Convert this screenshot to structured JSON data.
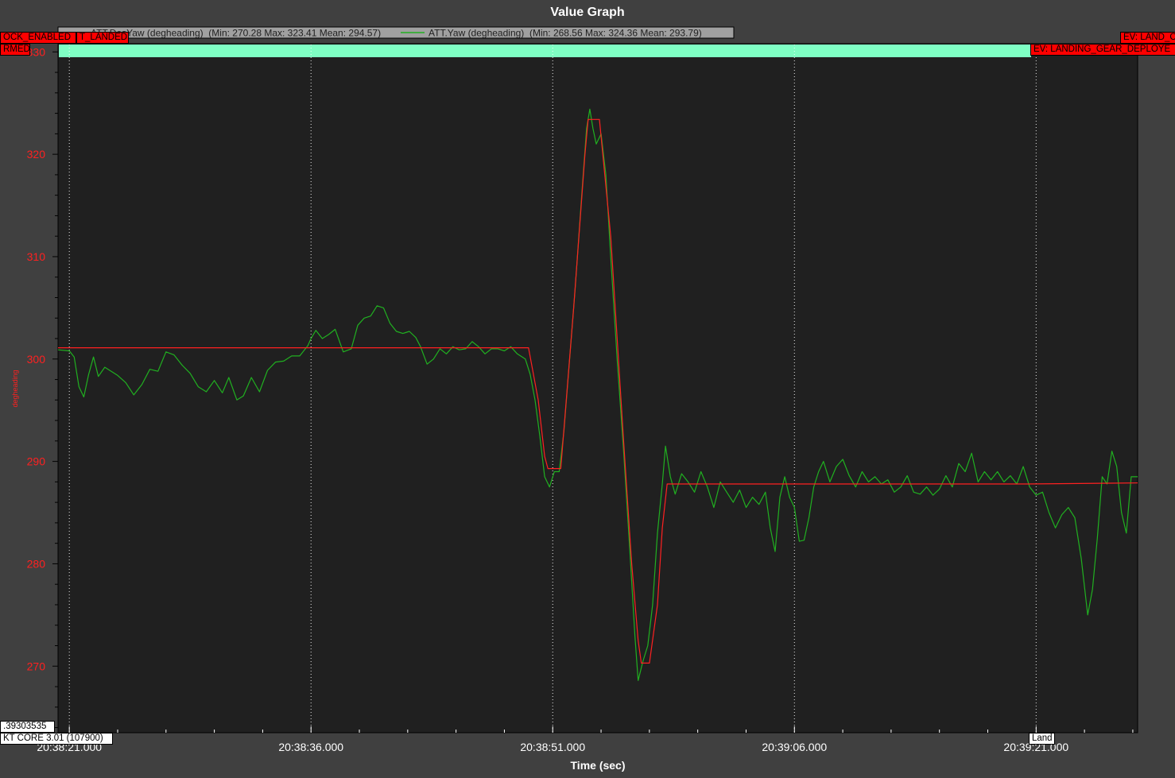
{
  "window": {
    "title": "Value Graph"
  },
  "colors": {
    "background": "#404040",
    "plot_background": "#202020",
    "axis_text": "#ff2020",
    "tick_text": "#ffffff",
    "grid": "#ffffff",
    "mode_band": "#7fffc4",
    "event_tag": "#ff0000"
  },
  "events": {
    "top_left_1": "OCK_ENABLED",
    "top_left_2": "T_LANDED",
    "top_left_3": "RMED",
    "top_right_1": "EV: LAND_C",
    "top_right_2": "EV: LANDING_GEAR_DEPLOYE",
    "bottom_land": "Land"
  },
  "info": {
    "value_box": ".39303535",
    "firmware_box": "KT CORE 3.01 (107900)"
  },
  "chart_data": {
    "type": "line",
    "title": "Value Graph",
    "xlabel": "Time (sec)",
    "ylabel": "degheading",
    "x_unit": "seconds from 20:38:21.000",
    "xlim": [
      -0.7,
      66.3
    ],
    "ylim": [
      263.5,
      330.8
    ],
    "y_ticks": [
      270,
      280,
      290,
      300,
      310,
      320,
      330
    ],
    "x_ticks": [
      {
        "t": 0,
        "label": "20:38:21.000"
      },
      {
        "t": 15,
        "label": "20:38:36.000"
      },
      {
        "t": 30,
        "label": "20:38:51.000"
      },
      {
        "t": 45,
        "label": "20:39:06.000"
      },
      {
        "t": 60,
        "label": "20:39:21.000"
      }
    ],
    "grid": true,
    "legend_position": "top",
    "series": [
      {
        "name": "ATT.DesYaw (degheading)  (Min: 270.28 Max: 323.41 Mean: 294.57)",
        "color": "#ff2020",
        "points": [
          [
            -0.7,
            301.1
          ],
          [
            28.5,
            301.1
          ],
          [
            29.1,
            296.0
          ],
          [
            29.5,
            290.5
          ],
          [
            29.7,
            289.3
          ],
          [
            30.5,
            289.3
          ],
          [
            31.3,
            305.0
          ],
          [
            32.0,
            320.0
          ],
          [
            32.2,
            323.4
          ],
          [
            32.9,
            323.4
          ],
          [
            33.6,
            312.0
          ],
          [
            34.4,
            292.0
          ],
          [
            34.9,
            280.0
          ],
          [
            35.3,
            272.5
          ],
          [
            35.5,
            270.3
          ],
          [
            36.0,
            270.3
          ],
          [
            36.5,
            276.0
          ],
          [
            36.8,
            283.5
          ],
          [
            37.1,
            287.8
          ],
          [
            59.5,
            287.8
          ],
          [
            66.3,
            287.9
          ]
        ]
      },
      {
        "name": "ATT.Yaw (degheading)  (Min: 268.56 Max: 324.36 Mean: 293.79)",
        "color": "#20b020",
        "points": [
          [
            -0.7,
            300.9
          ],
          [
            0.0,
            300.8
          ],
          [
            0.3,
            300.2
          ],
          [
            0.6,
            297.3
          ],
          [
            0.9,
            296.3
          ],
          [
            1.2,
            298.5
          ],
          [
            1.5,
            300.2
          ],
          [
            1.8,
            298.3
          ],
          [
            2.2,
            299.2
          ],
          [
            2.6,
            298.8
          ],
          [
            3.0,
            298.4
          ],
          [
            3.5,
            297.7
          ],
          [
            4.0,
            296.5
          ],
          [
            4.5,
            297.5
          ],
          [
            5.0,
            299.0
          ],
          [
            5.5,
            298.8
          ],
          [
            6.0,
            300.7
          ],
          [
            6.5,
            300.4
          ],
          [
            7.0,
            299.4
          ],
          [
            7.5,
            298.6
          ],
          [
            8.0,
            297.3
          ],
          [
            8.5,
            296.8
          ],
          [
            9.0,
            297.9
          ],
          [
            9.5,
            296.7
          ],
          [
            9.9,
            298.2
          ],
          [
            10.4,
            296.0
          ],
          [
            10.8,
            296.4
          ],
          [
            11.3,
            298.2
          ],
          [
            11.8,
            296.8
          ],
          [
            12.3,
            298.9
          ],
          [
            12.8,
            299.7
          ],
          [
            13.3,
            299.8
          ],
          [
            13.8,
            300.3
          ],
          [
            14.3,
            300.3
          ],
          [
            14.8,
            301.3
          ],
          [
            15.0,
            302.0
          ],
          [
            15.3,
            302.8
          ],
          [
            15.7,
            302.0
          ],
          [
            16.1,
            302.4
          ],
          [
            16.5,
            302.9
          ],
          [
            17.0,
            300.7
          ],
          [
            17.5,
            301.0
          ],
          [
            17.9,
            303.3
          ],
          [
            18.3,
            304.0
          ],
          [
            18.7,
            304.2
          ],
          [
            19.1,
            305.2
          ],
          [
            19.5,
            305.0
          ],
          [
            19.9,
            303.5
          ],
          [
            20.3,
            302.7
          ],
          [
            20.7,
            302.5
          ],
          [
            21.1,
            302.7
          ],
          [
            21.5,
            302.1
          ],
          [
            21.8,
            301.2
          ],
          [
            22.2,
            299.5
          ],
          [
            22.6,
            300.0
          ],
          [
            23.0,
            301.0
          ],
          [
            23.4,
            300.5
          ],
          [
            23.8,
            301.2
          ],
          [
            24.2,
            300.9
          ],
          [
            24.6,
            301.0
          ],
          [
            25.0,
            301.7
          ],
          [
            25.4,
            301.2
          ],
          [
            25.8,
            300.5
          ],
          [
            26.2,
            301.0
          ],
          [
            26.6,
            301.0
          ],
          [
            27.0,
            300.8
          ],
          [
            27.4,
            301.2
          ],
          [
            27.8,
            300.5
          ],
          [
            28.3,
            300.0
          ],
          [
            28.6,
            298.5
          ],
          [
            28.9,
            296.0
          ],
          [
            29.2,
            292.5
          ],
          [
            29.5,
            288.5
          ],
          [
            29.8,
            287.5
          ],
          [
            30.1,
            289.0
          ],
          [
            30.4,
            289.0
          ],
          [
            30.7,
            293.0
          ],
          [
            31.0,
            299.0
          ],
          [
            31.4,
            307.0
          ],
          [
            31.8,
            316.0
          ],
          [
            32.1,
            322.5
          ],
          [
            32.3,
            324.4
          ],
          [
            32.5,
            322.5
          ],
          [
            32.7,
            321.0
          ],
          [
            33.0,
            322.0
          ],
          [
            33.3,
            318.0
          ],
          [
            33.6,
            310.0
          ],
          [
            34.0,
            300.0
          ],
          [
            34.4,
            291.0
          ],
          [
            34.8,
            281.0
          ],
          [
            35.1,
            273.0
          ],
          [
            35.3,
            268.6
          ],
          [
            35.6,
            270.5
          ],
          [
            35.9,
            272.0
          ],
          [
            36.2,
            276.0
          ],
          [
            36.5,
            283.0
          ],
          [
            36.8,
            287.8
          ],
          [
            37.0,
            291.5
          ],
          [
            37.3,
            288.5
          ],
          [
            37.6,
            286.8
          ],
          [
            38.0,
            288.8
          ],
          [
            38.4,
            288.0
          ],
          [
            38.8,
            287.0
          ],
          [
            39.2,
            289.0
          ],
          [
            39.6,
            287.5
          ],
          [
            40.0,
            285.5
          ],
          [
            40.4,
            288.0
          ],
          [
            40.8,
            287.0
          ],
          [
            41.2,
            286.0
          ],
          [
            41.6,
            287.2
          ],
          [
            42.0,
            285.5
          ],
          [
            42.4,
            286.5
          ],
          [
            42.8,
            285.8
          ],
          [
            43.2,
            287.0
          ],
          [
            43.5,
            283.5
          ],
          [
            43.8,
            281.2
          ],
          [
            44.1,
            286.5
          ],
          [
            44.4,
            288.5
          ],
          [
            44.7,
            286.5
          ],
          [
            45.0,
            285.5
          ],
          [
            45.3,
            282.2
          ],
          [
            45.6,
            282.3
          ],
          [
            45.9,
            284.5
          ],
          [
            46.2,
            287.5
          ],
          [
            46.5,
            289.0
          ],
          [
            46.8,
            290.0
          ],
          [
            47.2,
            288.0
          ],
          [
            47.6,
            289.5
          ],
          [
            48.0,
            290.2
          ],
          [
            48.4,
            288.6
          ],
          [
            48.8,
            287.5
          ],
          [
            49.2,
            289.0
          ],
          [
            49.6,
            288.0
          ],
          [
            50.0,
            288.5
          ],
          [
            50.4,
            287.8
          ],
          [
            50.8,
            288.2
          ],
          [
            51.2,
            287.0
          ],
          [
            51.6,
            287.5
          ],
          [
            52.0,
            288.6
          ],
          [
            52.4,
            287.0
          ],
          [
            52.8,
            286.8
          ],
          [
            53.2,
            287.5
          ],
          [
            53.6,
            286.7
          ],
          [
            54.0,
            287.3
          ],
          [
            54.4,
            288.6
          ],
          [
            54.8,
            287.5
          ],
          [
            55.2,
            289.8
          ],
          [
            55.6,
            289.0
          ],
          [
            56.0,
            290.8
          ],
          [
            56.4,
            288.0
          ],
          [
            56.8,
            289.0
          ],
          [
            57.2,
            288.2
          ],
          [
            57.6,
            289.0
          ],
          [
            58.0,
            288.0
          ],
          [
            58.4,
            288.6
          ],
          [
            58.8,
            287.8
          ],
          [
            59.2,
            289.5
          ],
          [
            59.6,
            287.5
          ],
          [
            60.0,
            286.7
          ],
          [
            60.4,
            287.0
          ],
          [
            60.8,
            285.0
          ],
          [
            61.2,
            283.5
          ],
          [
            61.6,
            284.8
          ],
          [
            62.0,
            285.5
          ],
          [
            62.4,
            284.5
          ],
          [
            62.8,
            280.5
          ],
          [
            63.2,
            275.0
          ],
          [
            63.5,
            277.5
          ],
          [
            63.8,
            282.5
          ],
          [
            64.1,
            288.5
          ],
          [
            64.4,
            287.8
          ],
          [
            64.7,
            291.0
          ],
          [
            65.0,
            289.5
          ],
          [
            65.3,
            285.0
          ],
          [
            65.6,
            283.0
          ],
          [
            65.9,
            288.5
          ],
          [
            66.3,
            288.5
          ]
        ]
      }
    ]
  }
}
